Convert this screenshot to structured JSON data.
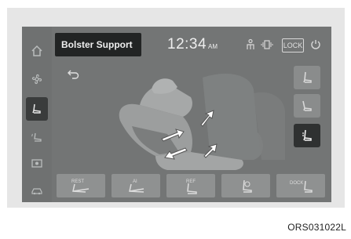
{
  "screen": {
    "title": "Bolster Support",
    "clock_time": "12:34",
    "clock_ampm": "AM",
    "lock_label": "LOCK"
  },
  "sidebar": {
    "items": [
      {
        "icon": "home-icon"
      },
      {
        "icon": "fan-icon"
      },
      {
        "icon": "seat-icon",
        "active": true
      },
      {
        "icon": "seat-heat-icon"
      },
      {
        "icon": "display-icon"
      },
      {
        "icon": "car-icon"
      }
    ]
  },
  "seat_positions": [
    {
      "icon": "seat-upright-icon"
    },
    {
      "icon": "seat-recline-icon"
    },
    {
      "icon": "seat-bolster-icon",
      "active": true
    }
  ],
  "bottom_buttons": [
    {
      "label": "REST"
    },
    {
      "label": "AI"
    },
    {
      "label": "REF"
    },
    {
      "label": ""
    },
    {
      "label": "DOCK"
    }
  ],
  "caption": "ORS031022L"
}
